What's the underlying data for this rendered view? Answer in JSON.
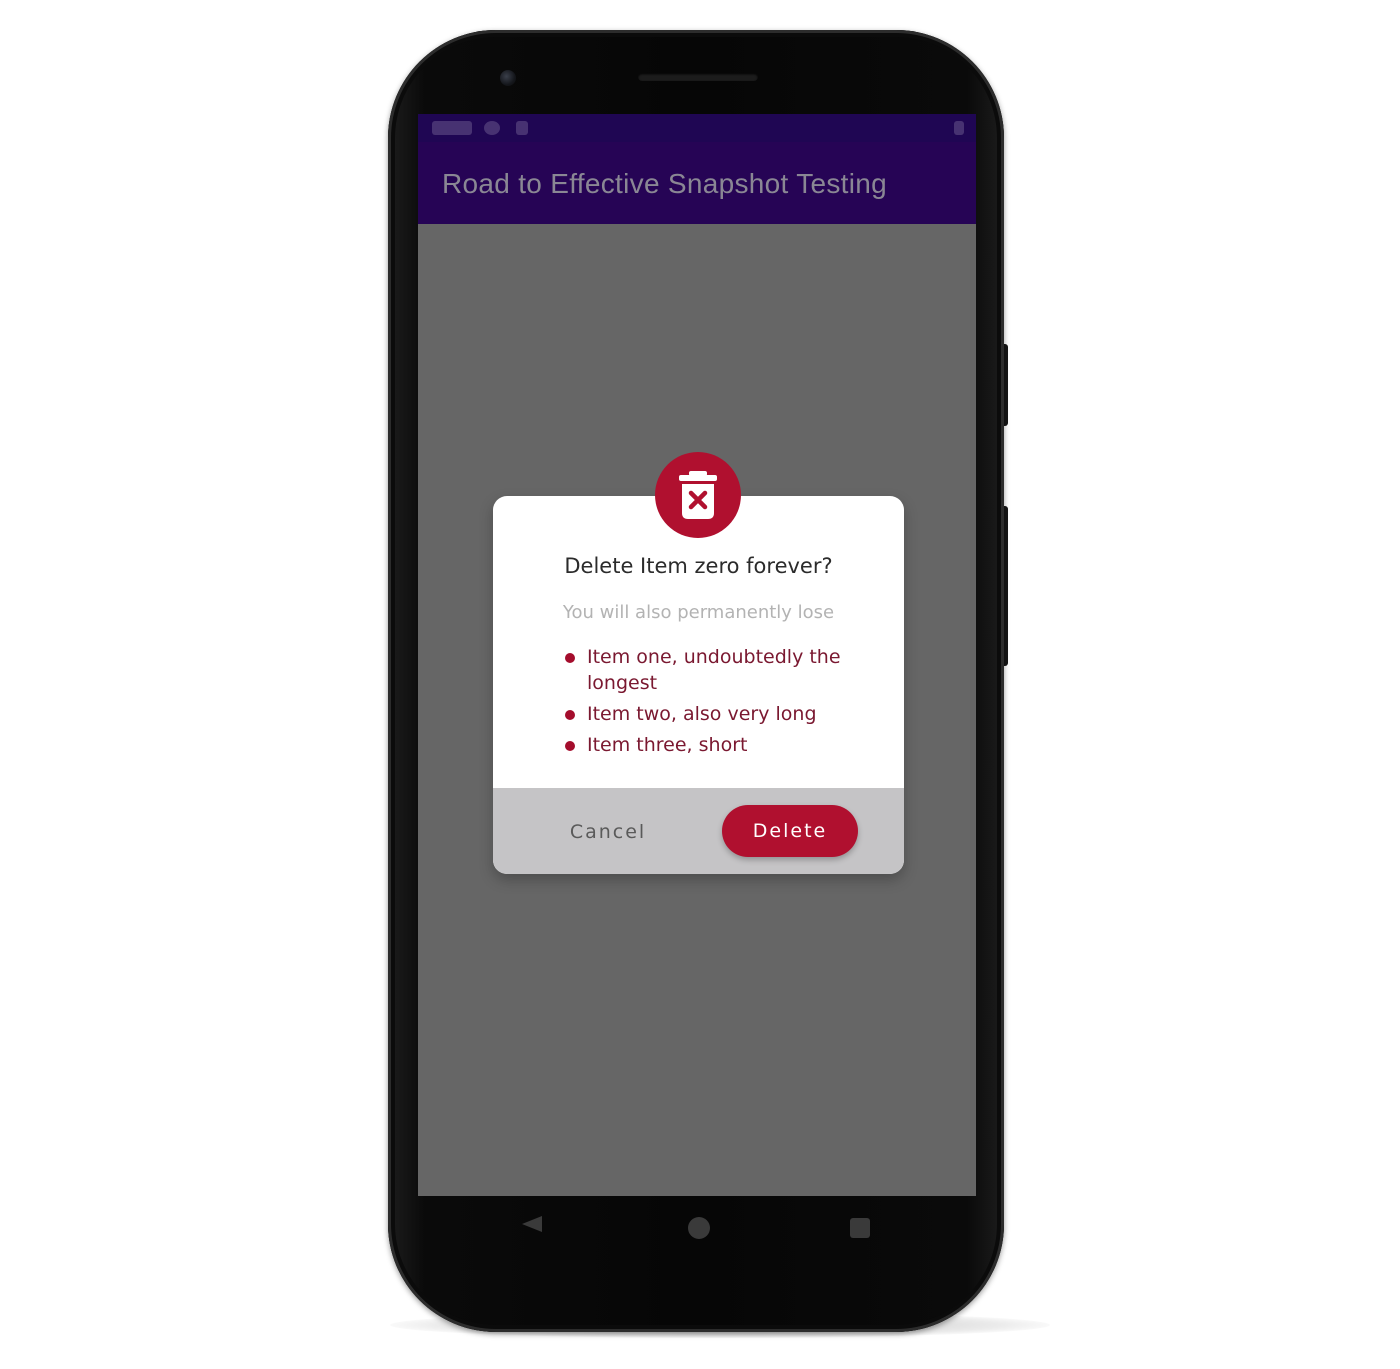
{
  "app_bar": {
    "title": "Road to Effective Snapshot Testing"
  },
  "dialog": {
    "icon": "trash-delete-icon",
    "title": "Delete Item zero forever?",
    "subtitle": "You will also permanently lose",
    "items": [
      "Item one, undoubtedly the longest",
      "Item two, also very long",
      "Item three, short"
    ],
    "cancel_label": "Cancel",
    "delete_label": "Delete"
  },
  "nav_bar": {
    "back_icon": "back-triangle-icon",
    "home_icon": "home-circle-icon",
    "recents_icon": "recents-square-icon"
  },
  "colors": {
    "app_bar": "#260455",
    "scrim": "#666666",
    "accent": "#b0102f",
    "dialog_footer": "#c5c4c6"
  }
}
